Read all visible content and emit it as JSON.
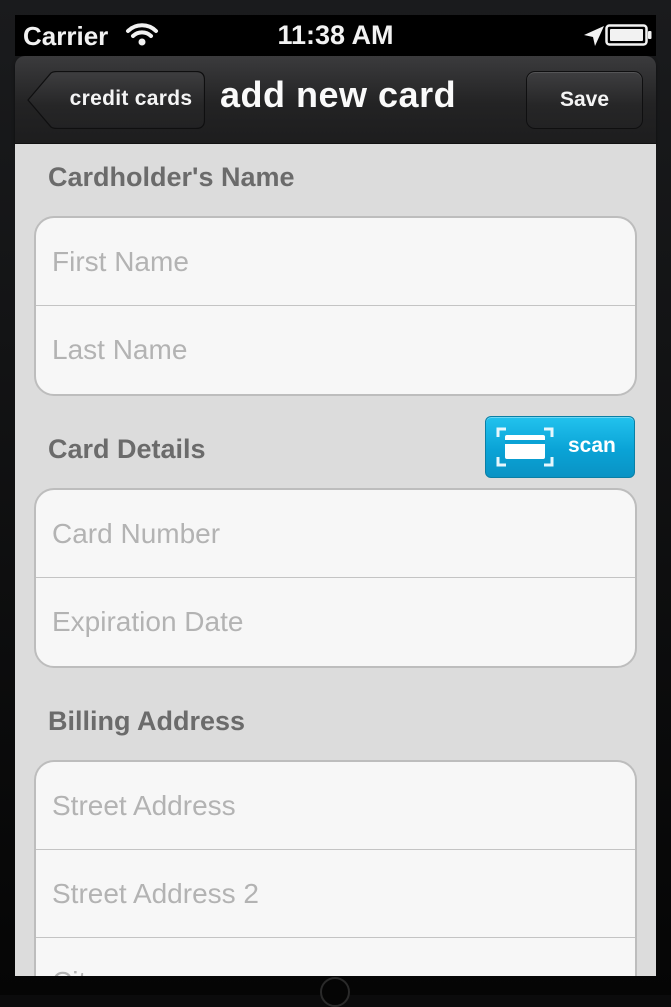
{
  "status_bar": {
    "carrier": "Carrier",
    "time": "11:38 AM",
    "icons": [
      "wifi-icon",
      "location-icon",
      "battery-icon"
    ]
  },
  "nav": {
    "back_label": "credit cards",
    "title": "add new card",
    "save_label": "Save"
  },
  "sections": {
    "cardholder": {
      "title": "Cardholder's Name",
      "first_name_placeholder": "First Name",
      "last_name_placeholder": "Last Name"
    },
    "card_details": {
      "title": "Card Details",
      "scan_label": "scan",
      "card_number_placeholder": "Card Number",
      "expiration_placeholder": "Expiration Date"
    },
    "billing": {
      "title": "Billing Address",
      "street_placeholder": "Street Address",
      "street2_placeholder": "Street Address 2",
      "city_placeholder": "City"
    }
  },
  "colors": {
    "scan_accent": "#0aa3d6",
    "nav_background": "#2a2a2b",
    "content_background": "#dcdcdc",
    "section_title": "#6b6b6b"
  }
}
